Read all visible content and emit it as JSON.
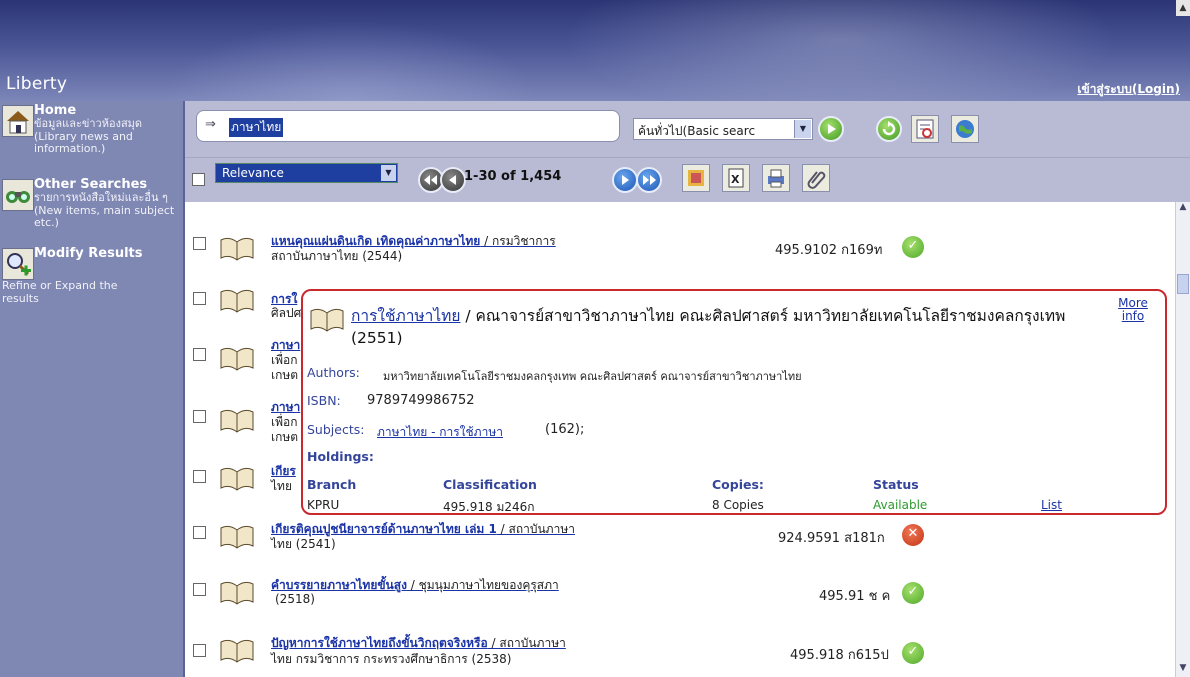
{
  "header": {
    "logo": "Liberty",
    "login": "เข้าสู่ระบบ(Login)"
  },
  "sidebar": {
    "items": [
      {
        "title": "Home",
        "desc": "ข้อมูลและข่าวห้องสมุด (Library news and information.)"
      },
      {
        "title": "Other Searches",
        "desc": "รายการหนังสือใหม่และอื่น ๆ (New items, main subject etc.)"
      },
      {
        "title": "Modify Results",
        "desc": "Refine or Expand the results"
      }
    ]
  },
  "search": {
    "arrow": "⇒",
    "value": "ภาษาไทย",
    "type": "ค้นทั่วไป(Basic searc",
    "dd": "▼"
  },
  "toolbar": {
    "sort": "Relevance",
    "dd": "▼",
    "pager": "1-30 of 1,454"
  },
  "results": [
    {
      "title": "แหนคุณแผ่นดินเกิด เทิดคุณค่าภาษาไทย",
      "rest": " / กรมวิชาการ",
      "line2": "สถาบันภาษาไทย  (2544)",
      "call": "495.9102 ก169ท",
      "status": "ok"
    },
    {
      "title": "การใ",
      "line2": "ศิลปศ"
    },
    {
      "title": "ภาษา",
      "line2": "เพื่อก",
      "line3": "เกษต"
    },
    {
      "title": "ภาษา",
      "line2": "เพื่อก",
      "line3": "เกษต"
    },
    {
      "title": "เกียร",
      "line2": "ไทย"
    },
    {
      "title": "เกียรติคุณปูชนียาจารย์ด้านภาษาไทย เล่ม 1",
      "rest": " / สถาบันภาษา",
      "line2": "ไทย  (2541)",
      "call": "924.9591 ส181ก",
      "status": "bad"
    },
    {
      "title": "คำบรรยายภาษาไทยขั้นสูง",
      "rest": " / ชุมนุมภาษาไทยของคุรุสภา",
      "line2": "(2518)",
      "call": "495.91 ช ค",
      "status": "ok"
    },
    {
      "title": "ปัญหาการใช้ภาษาไทยถึงขั้นวิกฤตจริงหรือ",
      "rest": " / สถาบันภาษา",
      "line2": "ไทย กรมวิชาการ กระทรวงศึกษาธิการ  (2538)",
      "call": "495.918 ก615ป",
      "status": "ok"
    }
  ],
  "popup": {
    "title": "การใช้ภาษาไทย",
    "title_rest": " / คณาจารย์สาขาวิชาภาษาไทย คณะศิลปศาสตร์ มหาวิทยาลัยเทคโนโลยีราชมงคลกรุงเทพ  (2551)",
    "more": "More info",
    "authors_label": "Authors:",
    "authors": "มหาวิทยาลัยเทคโนโลยีราชมงคลกรุงเทพ คณะศิลปศาสตร์ คณาจารย์สาขาวิชาภาษาไทย",
    "isbn_label": "ISBN:",
    "isbn": "9789749986752",
    "subjects_label": "Subjects:",
    "subject_link": "ภาษาไทย - การใช้ภาษา",
    "subject_count": "(162);",
    "holdings_label": "Holdings:",
    "col_branch": "Branch",
    "col_class": "Classification",
    "col_copies": "Copies:",
    "col_status": "Status",
    "branch": "KPRU",
    "classification": "495.918 ม246ก",
    "copies": "8 Copies",
    "status": "Available",
    "list": "List"
  },
  "colors": {
    "accent": "#1a33a6",
    "header": "#2b3575",
    "sidebar": "#7f87b3",
    "available": "#2e9a2e",
    "popup_border": "#c9282e"
  }
}
